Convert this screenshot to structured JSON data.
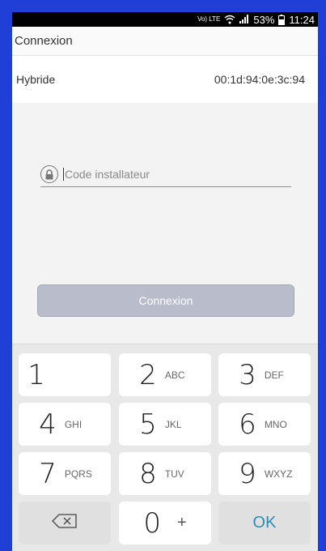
{
  "status_bar": {
    "volte": "Vo) LTE",
    "battery_percent": "53%",
    "time": "11:24"
  },
  "header": {
    "title": "Connexion"
  },
  "device": {
    "name": "Hybride",
    "mac": "00:1d:94:0e:3c:94"
  },
  "form": {
    "code_placeholder": "Code installateur",
    "code_value": "",
    "submit_label": "Connexion"
  },
  "keypad": {
    "keys": [
      {
        "digit": "1",
        "letters": ""
      },
      {
        "digit": "2",
        "letters": "ABC"
      },
      {
        "digit": "3",
        "letters": "DEF"
      },
      {
        "digit": "4",
        "letters": "GHI"
      },
      {
        "digit": "5",
        "letters": "JKL"
      },
      {
        "digit": "6",
        "letters": "MNO"
      },
      {
        "digit": "7",
        "letters": "PQRS"
      },
      {
        "digit": "8",
        "letters": "TUV"
      },
      {
        "digit": "9",
        "letters": "WXYZ"
      }
    ],
    "zero": {
      "digit": "0",
      "symbol": "+"
    },
    "backspace_icon": "backspace-icon",
    "ok_label": "OK"
  },
  "colors": {
    "frame_border": "#1f3fd6",
    "button_disabled": "#b9bccb",
    "ok_accent": "#2e8bb6"
  }
}
